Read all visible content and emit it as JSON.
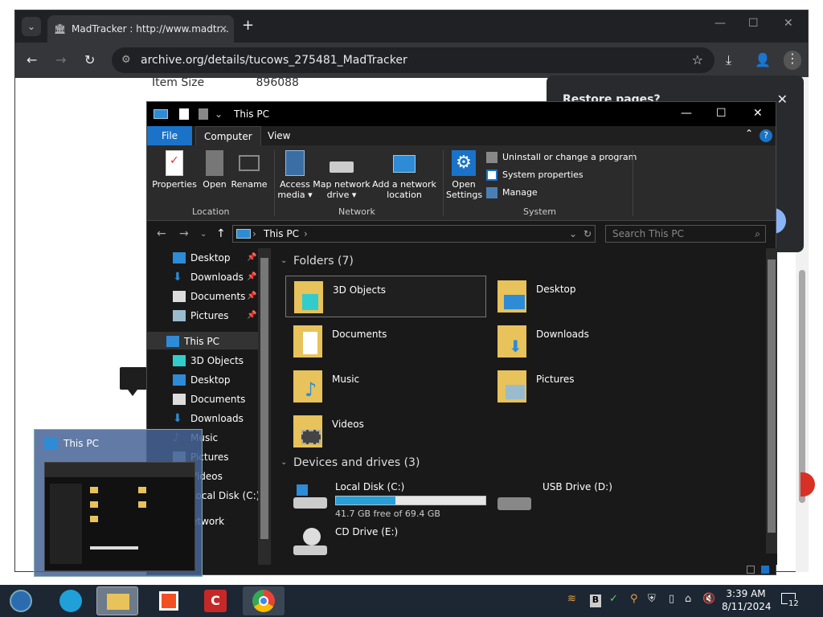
{
  "chrome": {
    "tab_title": "MadTracker : http://www.madtr...",
    "url": "archive.org/details/tucows_275481_MadTracker",
    "page_label": "Item Size",
    "page_value": "896088",
    "restore_title": "Restore pages?"
  },
  "explorer": {
    "title": "This PC",
    "tabs": [
      "File",
      "Computer",
      "View"
    ],
    "ribbon": {
      "properties": "Properties",
      "open": "Open",
      "rename": "Rename",
      "access_media": "Access media",
      "map_network_drive": "Map network drive",
      "add_network_location": "Add a network location",
      "open_settings": "Open Settings",
      "uninstall": "Uninstall or change a program",
      "system_properties": "System properties",
      "manage": "Manage",
      "group_location": "Location",
      "group_network": "Network",
      "group_system": "System"
    },
    "address": "This PC",
    "search_placeholder": "Search This PC",
    "nav": {
      "quick": [
        "Desktop",
        "Downloads",
        "Documents",
        "Pictures"
      ],
      "this_pc": "This PC",
      "pc_children": [
        "3D Objects",
        "Desktop",
        "Documents",
        "Downloads",
        "Music",
        "Pictures",
        "Videos",
        "Local Disk (C:)"
      ],
      "network": "Network"
    },
    "folders_header": "Folders (7)",
    "folders": [
      "3D Objects",
      "Desktop",
      "Documents",
      "Downloads",
      "Music",
      "Pictures",
      "Videos"
    ],
    "drives_header": "Devices and drives (3)",
    "drives": {
      "c_name": "Local Disk (C:)",
      "c_free": "41.7 GB free of 69.4 GB",
      "c_used_fraction": 0.4,
      "d_name": "USB Drive (D:)",
      "e_name": "CD Drive (E:)"
    }
  },
  "thumbnail": {
    "title": "This PC"
  },
  "taskbar": {
    "time": "3:39 AM",
    "date": "8/11/2024",
    "notifications": "12"
  },
  "colors": {
    "accent": "#1a73c8",
    "drive_bar": "#26a0da"
  }
}
